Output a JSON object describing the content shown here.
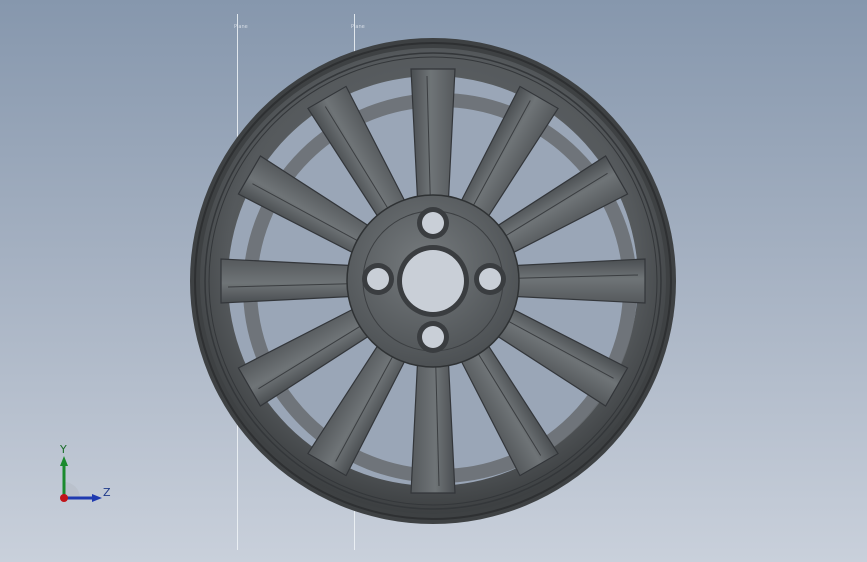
{
  "viewport": {
    "background_top": "#8697ad",
    "background_bottom": "#c9d0db",
    "model": "wheel-rim",
    "spoke_count": 12,
    "bolt_hole_count": 4,
    "reference_planes": [
      {
        "name": "reference-plane-1",
        "label": "Plane"
      },
      {
        "name": "reference-plane-2",
        "label": "Plane"
      }
    ]
  },
  "triad": {
    "y_label": "Y",
    "z_label": "Z",
    "y_color": "#1b8a2e",
    "z_color": "#1f3ab0",
    "x_color": "#c0141a"
  },
  "colors": {
    "rim_dark": "#3f4244",
    "rim_mid": "#5b5f62",
    "rim_light": "#7b8083",
    "hole_fill": "#c9cfd7"
  }
}
